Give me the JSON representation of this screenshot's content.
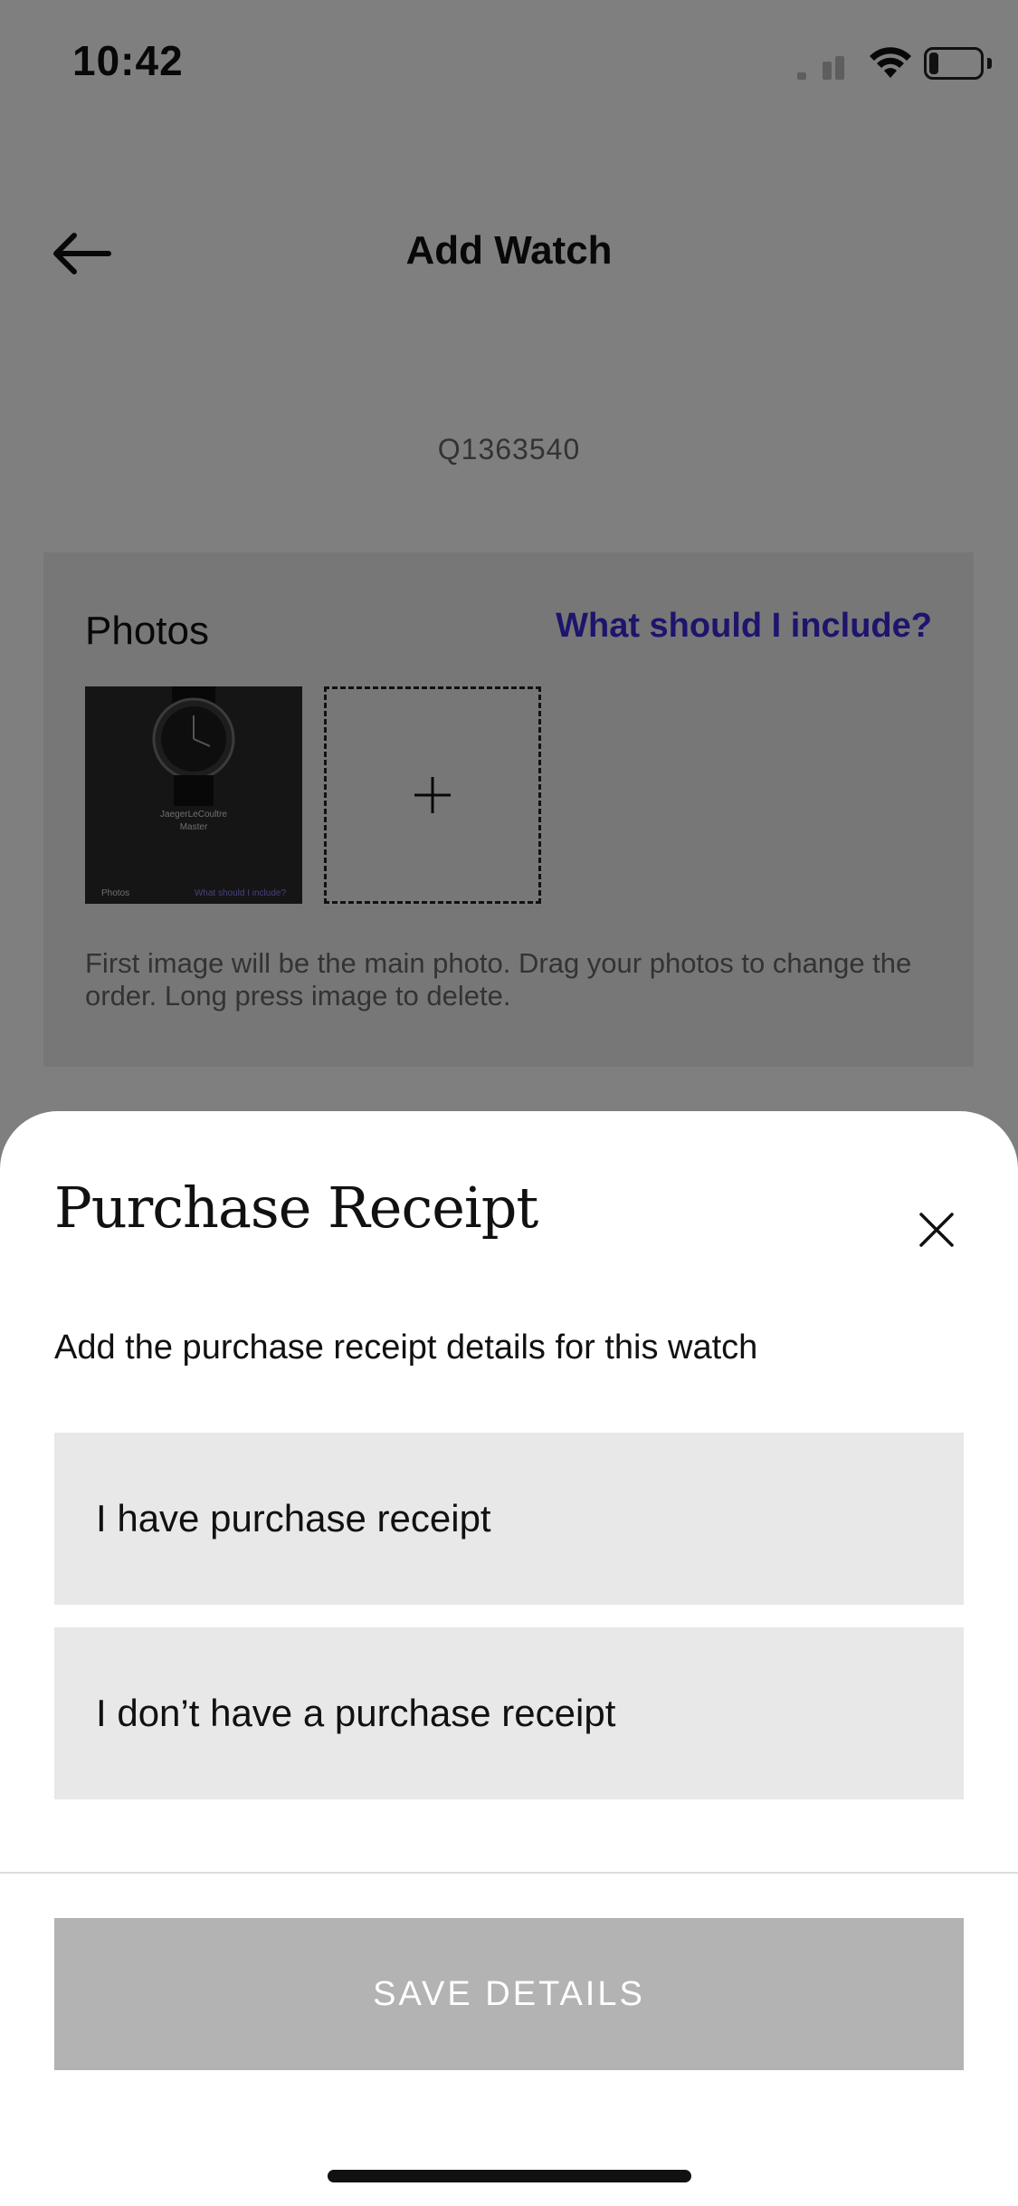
{
  "status_bar": {
    "time": "10:42",
    "battery": "29"
  },
  "header": {
    "title": "Add Watch",
    "back_icon": "arrow-left-icon"
  },
  "reference": "Q1363540",
  "photos": {
    "title": "Photos",
    "help_link": "What should I include?",
    "hint": "First image will be the main photo. Drag your photos to change the order. Long press image to delete.",
    "thumbnail": {
      "brand": "JaegerLeCoultre",
      "model": "Master",
      "mini_title": "Photos",
      "mini_link": "What should I include?"
    }
  },
  "sheet": {
    "title": "Purchase Receipt",
    "subtitle": "Add the purchase receipt details for this watch",
    "options": [
      {
        "label": "I have purchase receipt"
      },
      {
        "label": "I don’t have a purchase receipt"
      }
    ],
    "save_label": "SAVE DETAILS"
  },
  "colors": {
    "accent_link": "#3a2bd8",
    "disabled_button": "#b3b3b3",
    "option_bg": "#e8e8e8"
  }
}
